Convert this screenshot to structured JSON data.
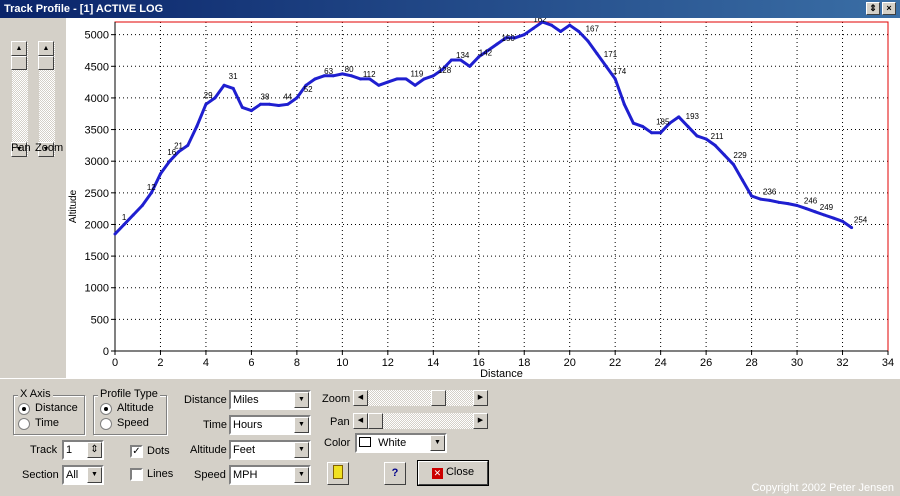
{
  "window": {
    "title": "Track Profile - [1] ACTIVE LOG",
    "buttons": [
      "⇕",
      "×"
    ]
  },
  "left_panel": {
    "pan_label": "Pan",
    "zoom_label": "Zoom"
  },
  "chart_data": {
    "type": "line",
    "title": "",
    "xlabel": "Distance",
    "ylabel": "Altitude",
    "xlim": [
      0,
      34
    ],
    "ylim": [
      0,
      5200
    ],
    "xticks": [
      0,
      2,
      4,
      6,
      8,
      10,
      12,
      14,
      16,
      18,
      20,
      22,
      24,
      26,
      28,
      30,
      32,
      34
    ],
    "yticks": [
      0,
      500,
      1000,
      1500,
      2000,
      2500,
      3000,
      3500,
      4000,
      4500,
      5000
    ],
    "grid": "dotted",
    "line_color": "#1f1fd0",
    "series": [
      {
        "x": [
          0,
          0.4,
          0.8,
          1.2,
          1.6,
          2.0,
          2.4,
          2.8,
          3.2,
          3.6,
          4.0,
          4.4,
          4.8,
          5.2,
          5.6,
          6.0,
          6.4,
          6.8,
          7.2,
          7.6,
          8.0,
          8.4,
          8.8,
          9.2,
          9.6,
          10.0,
          10.4,
          10.8,
          11.2,
          11.6,
          12.0,
          12.4,
          12.8,
          13.2,
          13.6,
          14.0,
          14.4,
          14.8,
          15.2,
          15.6,
          16.0,
          16.4,
          16.8,
          17.2,
          17.6,
          18.0,
          18.4,
          18.8,
          19.2,
          19.6,
          20.0,
          20.4,
          20.8,
          21.2,
          21.6,
          22.0,
          22.4,
          22.8,
          23.2,
          23.6,
          24.0,
          24.4,
          24.8,
          25.2,
          25.6,
          26.0,
          26.4,
          26.8,
          27.2,
          27.6,
          28.0,
          28.4,
          28.8,
          29.2,
          29.6,
          30.0,
          30.4,
          30.8,
          31.2,
          31.6,
          32.0,
          32.4
        ],
        "y": [
          1850,
          2000,
          2150,
          2300,
          2500,
          2800,
          3000,
          3150,
          3250,
          3550,
          3900,
          4000,
          4200,
          4150,
          3850,
          3800,
          3900,
          3900,
          3880,
          3900,
          4000,
          4200,
          4300,
          4350,
          4350,
          4380,
          4350,
          4300,
          4300,
          4200,
          4250,
          4300,
          4300,
          4200,
          4300,
          4350,
          4450,
          4600,
          4600,
          4500,
          4650,
          4750,
          4850,
          4950,
          4950,
          5000,
          5100,
          5200,
          5150,
          5050,
          5150,
          5050,
          4900,
          4700,
          4500,
          4300,
          3900,
          3600,
          3550,
          3450,
          3450,
          3600,
          3700,
          3550,
          3400,
          3350,
          3250,
          3100,
          2950,
          2700,
          2450,
          2400,
          2380,
          2350,
          2330,
          2300,
          2250,
          2200,
          2150,
          2100,
          2050,
          1950
        ]
      }
    ],
    "waypoint_labels": [
      {
        "x": 0.3,
        "y": 2020,
        "text": "1"
      },
      {
        "x": 1.4,
        "y": 2500,
        "text": "12"
      },
      {
        "x": 2.3,
        "y": 3050,
        "text": "16"
      },
      {
        "x": 2.6,
        "y": 3150,
        "text": "21"
      },
      {
        "x": 3.9,
        "y": 3950,
        "text": "29"
      },
      {
        "x": 5.0,
        "y": 4250,
        "text": "31"
      },
      {
        "x": 6.4,
        "y": 3930,
        "text": "38"
      },
      {
        "x": 7.4,
        "y": 3930,
        "text": "44"
      },
      {
        "x": 8.3,
        "y": 4050,
        "text": "52"
      },
      {
        "x": 9.2,
        "y": 4330,
        "text": "63"
      },
      {
        "x": 10.1,
        "y": 4360,
        "text": "80"
      },
      {
        "x": 10.9,
        "y": 4280,
        "text": "112"
      },
      {
        "x": 13.0,
        "y": 4290,
        "text": "119"
      },
      {
        "x": 14.2,
        "y": 4350,
        "text": "128"
      },
      {
        "x": 15.0,
        "y": 4580,
        "text": "134"
      },
      {
        "x": 16.0,
        "y": 4620,
        "text": "142"
      },
      {
        "x": 17.0,
        "y": 4850,
        "text": "150"
      },
      {
        "x": 18.4,
        "y": 5150,
        "text": "162"
      },
      {
        "x": 20.7,
        "y": 5000,
        "text": "167"
      },
      {
        "x": 21.5,
        "y": 4600,
        "text": "171"
      },
      {
        "x": 21.9,
        "y": 4330,
        "text": "174"
      },
      {
        "x": 23.8,
        "y": 3530,
        "text": "185"
      },
      {
        "x": 25.1,
        "y": 3620,
        "text": "193"
      },
      {
        "x": 26.2,
        "y": 3300,
        "text": "211"
      },
      {
        "x": 27.2,
        "y": 3000,
        "text": "229"
      },
      {
        "x": 28.5,
        "y": 2430,
        "text": "236"
      },
      {
        "x": 30.3,
        "y": 2280,
        "text": "246"
      },
      {
        "x": 31.0,
        "y": 2180,
        "text": "249"
      },
      {
        "x": 32.5,
        "y": 1980,
        "text": "254"
      }
    ]
  },
  "controls": {
    "x_axis": {
      "title": "X Axis",
      "options": [
        "Distance",
        "Time"
      ],
      "selected": "Distance"
    },
    "profile_type": {
      "title": "Profile Type",
      "options": [
        "Altitude",
        "Speed"
      ],
      "selected": "Altitude"
    },
    "track": {
      "label": "Track",
      "value": "1"
    },
    "section": {
      "label": "Section",
      "value": "All"
    },
    "dots": {
      "label": "Dots",
      "checked": true,
      "mark": "✓"
    },
    "lines": {
      "label": "Lines",
      "checked": false
    },
    "distance": {
      "label": "Distance",
      "value": "Miles"
    },
    "time": {
      "label": "Time",
      "value": "Hours"
    },
    "altitude": {
      "label": "Altitude",
      "value": "Feet"
    },
    "speed": {
      "label": "Speed",
      "value": "MPH"
    },
    "zoom_label": "Zoom",
    "pan_label": "Pan",
    "color": {
      "label": "Color",
      "value": "White"
    },
    "help_button": "?",
    "close_button": "Close"
  },
  "footer": {
    "copyright": "Copyright 2002 Peter Jensen"
  }
}
